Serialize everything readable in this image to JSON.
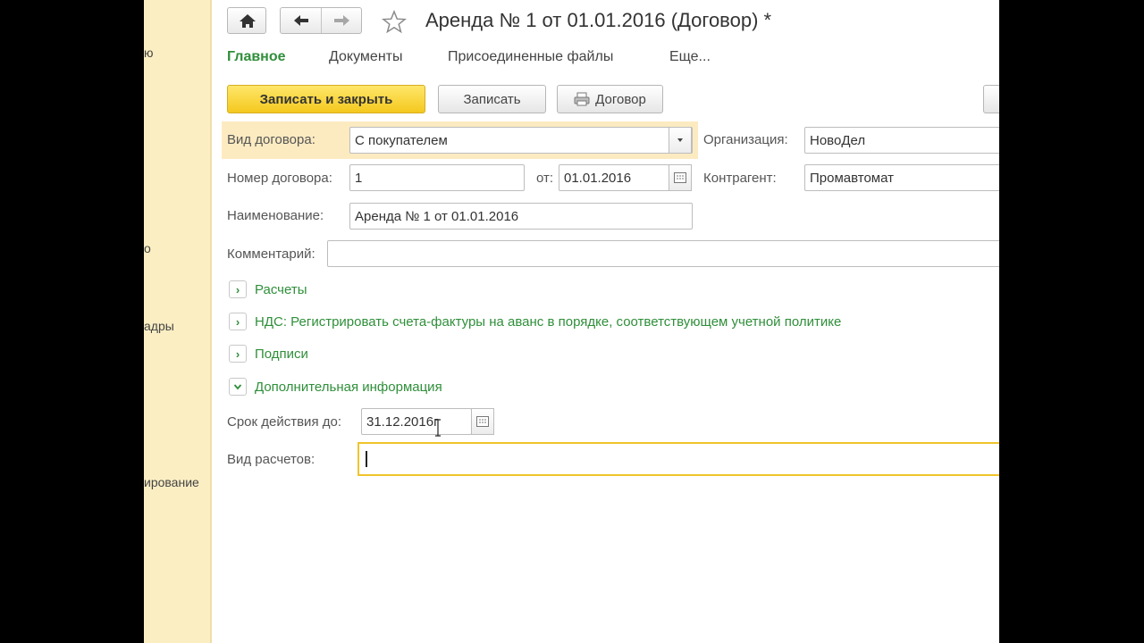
{
  "sidebar": {
    "items": [
      "ю",
      "о",
      "адры",
      "ирование"
    ]
  },
  "toolbar": {
    "home_icon": "home-icon",
    "back_icon": "arrow-left-icon",
    "forward_icon": "arrow-right-icon",
    "favorite_icon": "star-icon",
    "title": "Аренда № 1 от 01.01.2016 (Договор) *"
  },
  "tabs": [
    {
      "label": "Главное",
      "active": true
    },
    {
      "label": "Документы",
      "active": false
    },
    {
      "label": "Присоединенные файлы",
      "active": false
    },
    {
      "label": "Еще...",
      "active": false
    }
  ],
  "commands": {
    "save_close": "Записать и закрыть",
    "save": "Записать",
    "print": "Договор"
  },
  "form": {
    "contract_type": {
      "label": "Вид договора:",
      "value": "С покупателем"
    },
    "organization": {
      "label": "Организация:",
      "value": "НовоДел"
    },
    "contract_number": {
      "label": "Номер договора:",
      "value": "1"
    },
    "date": {
      "label": "от:",
      "value": "01.01.2016"
    },
    "counterparty": {
      "label": "Контрагент:",
      "value": "Промавтомат"
    },
    "name": {
      "label": "Наименование:",
      "value": "Аренда № 1 от 01.01.2016"
    },
    "comment": {
      "label": "Комментарий:",
      "value": ""
    }
  },
  "sections": [
    {
      "label": "Расчеты",
      "expanded": false
    },
    {
      "label": "НДС: Регистрировать счета-фактуры на аванс в порядке, соответствующем учетной политике",
      "expanded": false
    },
    {
      "label": "Подписи",
      "expanded": false
    },
    {
      "label": "Дополнительная информация",
      "expanded": true
    }
  ],
  "extra": {
    "valid_until": {
      "label": "Срок действия до:",
      "value": "31.12.2016г"
    },
    "settlement_type": {
      "label": "Вид расчетов:",
      "value": ""
    }
  },
  "colors": {
    "accent_green": "#2f8f3a",
    "primary_button": "#f4c81e",
    "sidebar_bg": "#fbeec3",
    "highlight_row": "#fcebc1"
  }
}
